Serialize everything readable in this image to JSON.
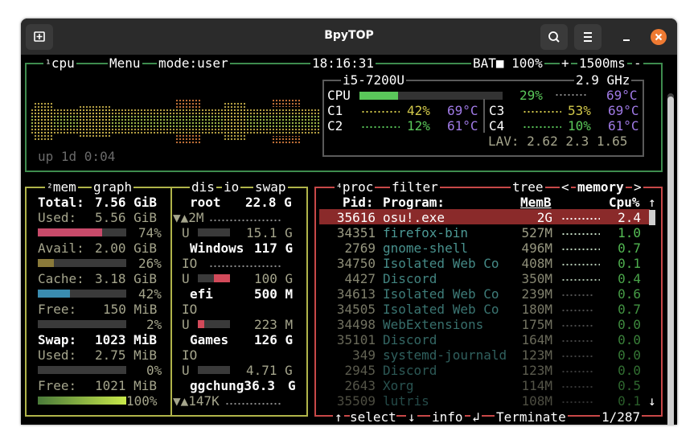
{
  "window": {
    "title": "BpyTOP"
  },
  "cpu": {
    "tag": "¹",
    "label": "cpu",
    "menu": "Menu",
    "mode": "mode:user",
    "clock": "18:16:31",
    "battery": "BAT■ 100%",
    "plus": "+",
    "interval": "1500ms",
    "minus": "-",
    "model": "i5-7200U",
    "freq": "2.9 GHz",
    "total_label": "CPU",
    "total_pct": "29%",
    "total_temp": "69°C",
    "cores": [
      {
        "name": "C1",
        "pct": "42%",
        "temp": "69°C"
      },
      {
        "name": "C2",
        "pct": "12%",
        "temp": "61°C"
      },
      {
        "name": "C3",
        "pct": "53%",
        "temp": "69°C"
      },
      {
        "name": "C4",
        "pct": "10%",
        "temp": "61°C"
      }
    ],
    "load": "LAV: 2.62 2.3 1.65",
    "uptime": "up 1d 0:04"
  },
  "mem": {
    "tag": "²",
    "label": "mem",
    "graph": "graph",
    "rows": [
      {
        "label": "Total:",
        "value": "7.56 GiB"
      },
      {
        "label": "Used:",
        "value": "5.56 GiB",
        "pct": "74%"
      },
      {
        "label": "Avail:",
        "value": "2.00 GiB",
        "pct": "26%"
      },
      {
        "label": "Cache:",
        "value": "3.18 GiB",
        "pct": "42%"
      },
      {
        "label": "Free:",
        "value": "150 MiB",
        "pct": "2%"
      }
    ],
    "swap": [
      {
        "label": "Swap:",
        "value": "1023 MiB"
      },
      {
        "label": "Used:",
        "value": "2.75 MiB",
        "pct": "0%"
      },
      {
        "label": "Free:",
        "value": "1021 MiB",
        "pct": "100%"
      }
    ]
  },
  "disks": {
    "label": "dis",
    "io": "io",
    "swap": "swap",
    "items": [
      {
        "name": "root",
        "size": "22.8 G",
        "io": "▼▲2M",
        "used": "U",
        "free": "15.1 G"
      },
      {
        "name": "Windows",
        "size": "117 G",
        "io": "IO",
        "used": "U",
        "free": "100 G"
      },
      {
        "name": "efi",
        "size": "500 M",
        "io": "IO",
        "used": "U",
        "free": "223 M"
      },
      {
        "name": "Games",
        "size": "126 G",
        "io": "IO",
        "used": "U",
        "free": "4.71 G"
      },
      {
        "name": "ggchung36.3",
        "size": "G",
        "io": "▼▲147K"
      }
    ]
  },
  "proc": {
    "tag": "⁴",
    "label": "proc",
    "filter": "filter",
    "tree": "tree",
    "sort_left": "<",
    "sort": "memory",
    "sort_right": ">",
    "headers": {
      "pid": "Pid:",
      "program": "Program:",
      "mem": "MemB",
      "cpu": "Cpu%",
      "arrow": "↑"
    },
    "rows": [
      {
        "pid": "35616",
        "program": "osu!.exe",
        "mem": "2G",
        "cpu": "2.4"
      },
      {
        "pid": "34351",
        "program": "firefox-bin",
        "mem": "527M",
        "cpu": "1.0"
      },
      {
        "pid": "2769",
        "program": "gnome-shell",
        "mem": "496M",
        "cpu": "0.7"
      },
      {
        "pid": "34750",
        "program": "Isolated Web Co",
        "mem": "408M",
        "cpu": "0.1"
      },
      {
        "pid": "4427",
        "program": "Discord",
        "mem": "350M",
        "cpu": "0.4"
      },
      {
        "pid": "34613",
        "program": "Isolated Web Co",
        "mem": "239M",
        "cpu": "0.6"
      },
      {
        "pid": "34505",
        "program": "Isolated Web Co",
        "mem": "180M",
        "cpu": "0.7"
      },
      {
        "pid": "34498",
        "program": "WebExtensions",
        "mem": "175M",
        "cpu": "0.0"
      },
      {
        "pid": "35101",
        "program": "Discord",
        "mem": "164M",
        "cpu": "0.0"
      },
      {
        "pid": "349",
        "program": "systemd-journald",
        "mem": "123M",
        "cpu": "0.0"
      },
      {
        "pid": "2945",
        "program": "Discord",
        "mem": "123M",
        "cpu": "0.0"
      },
      {
        "pid": "2643",
        "program": "Xorg",
        "mem": "114M",
        "cpu": "0.5"
      },
      {
        "pid": "35509",
        "program": "lutris",
        "mem": "108M",
        "cpu": "0.1"
      }
    ],
    "scroll_down": "↓",
    "footer": {
      "up": "↑",
      "select": "select",
      "down": "↓",
      "info": "info",
      "enter": "↲",
      "terminate": "Terminate",
      "count": "1/287"
    }
  },
  "colors": {
    "cpu_box": "#3e8c4e",
    "mem_box": "#b0b44a",
    "proc_box": "#c84848",
    "selected_row": "#8a2a2a"
  }
}
